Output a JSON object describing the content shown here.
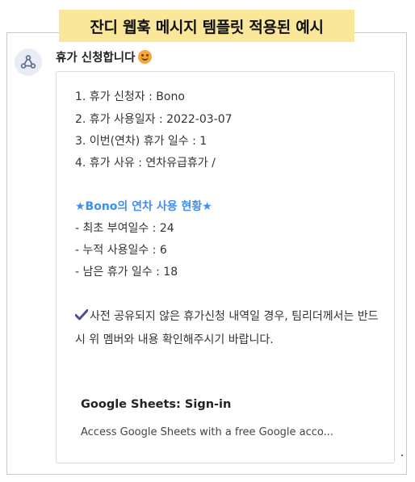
{
  "banner": {
    "title": "잔디 웹훅 메시지 템플릿 적용된 예시"
  },
  "message": {
    "title": "휴가 신청합니다",
    "avatar_icon": "webhook-icon",
    "title_emoji": "smiling-face-emoji",
    "lines": [
      "1. 휴가 신청자 : Bono",
      "2. 휴가 사용일자 : 2022-03-07",
      "3. 이번(연차) 휴가 일수  : 1",
      "4. 휴가 사유 : 연차유급휴가 /"
    ],
    "status_title": "★Bono의 연차 사용 현황★",
    "status_lines": [
      "- 최초 부여일수 : 24",
      "- 누적 사용일수 : 6",
      "- 남은 휴가 일수 : 18"
    ],
    "notice_icon": "check-mark-icon",
    "notice": "사전 공유되지 않은 휴가신청 내역일 경우, 팀리더께서는 반드시 위 멤버와 내용 확인해주시기 바랍니다."
  },
  "link_preview": {
    "title": "Google Sheets: Sign-in",
    "description": "Access Google Sheets with a free Google acco..."
  },
  "colors": {
    "banner_bg": "#fbe79a",
    "status_title": "#3d8ff5",
    "check_icon": "#4b4f9a"
  }
}
